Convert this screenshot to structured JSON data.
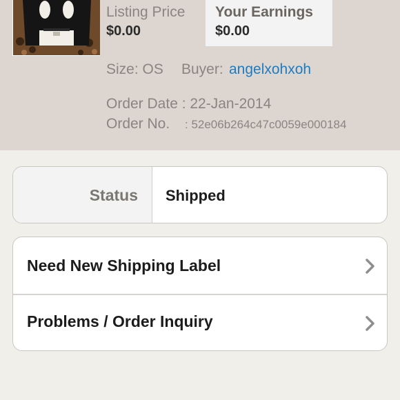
{
  "listing": {
    "price_label": "Listing Price",
    "price_value": "$0.00",
    "earnings_label": "Your Earnings",
    "earnings_value": "$0.00",
    "size_text": "Size: OS",
    "buyer_label": "Buyer:",
    "buyer_name": "angelxohxoh",
    "order_date_text": "Order Date : 22-Jan-2014",
    "order_no_label": "Order No.",
    "order_no_value": ": 52e06b264c47c0059e000184"
  },
  "status": {
    "label": "Status",
    "value": "Shipped"
  },
  "actions": [
    {
      "label": "Need New Shipping Label",
      "icon": "chevron-right-icon"
    },
    {
      "label": "Problems / Order Inquiry",
      "icon": "chevron-right-icon"
    }
  ],
  "colors": {
    "header_bg": "#ddd6d0",
    "link": "#1e7bbf",
    "page_bg": "#f1efe9"
  }
}
